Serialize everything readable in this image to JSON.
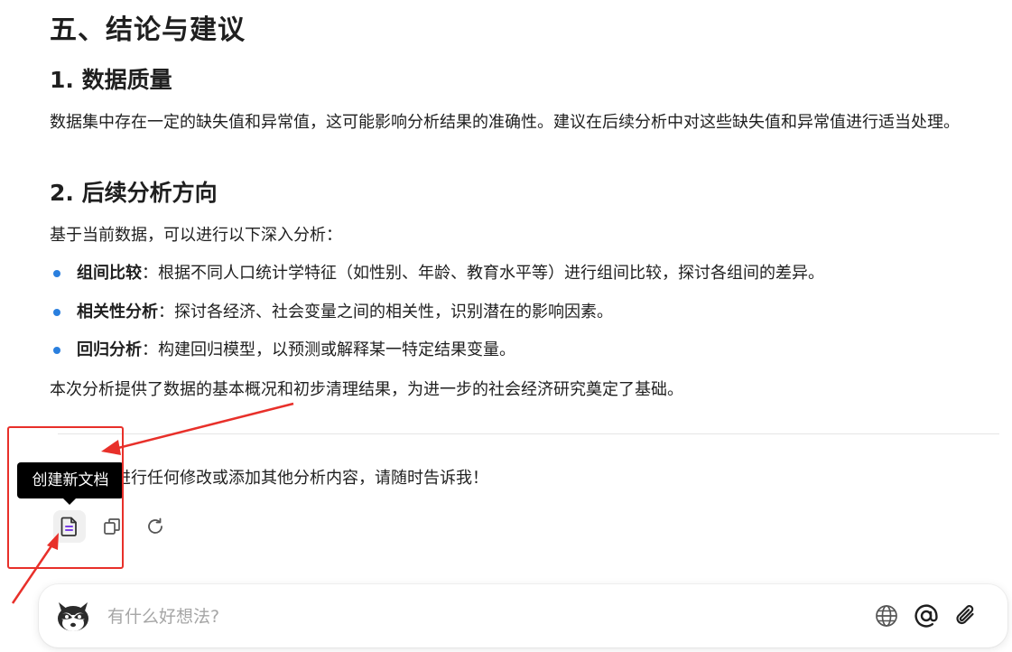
{
  "report": {
    "section_title": "五、结论与建议",
    "sub1_title": "1. 数据质量",
    "sub1_body": "数据集中存在一定的缺失值和异常值，这可能影响分析结果的准确性。建议在后续分析中对这些缺失值和异常值进行适当处理。",
    "sub2_title": "2. 后续分析方向",
    "sub2_intro": "基于当前数据，可以进行以下深入分析：",
    "bullets": [
      {
        "term": "组间比较",
        "text": "：根据不同人口统计学特征（如性别、年龄、教育水平等）进行组间比较，探讨各组间的差异。"
      },
      {
        "term": "相关性分析",
        "text": "：探讨各经济、社会变量之间的相关性，识别潜在的影响因素。"
      },
      {
        "term": "回归分析",
        "text": "：构建回归模型，以预测或解释某一特定结果变量。"
      }
    ],
    "closing": "本次分析提供了数据的基本概况和初步清理结果，为进一步的社会经济研究奠定了基础。"
  },
  "followup_text": "要对报告进行任何修改或添加其他分析内容，请随时告诉我！",
  "tooltip": "创建新文档",
  "actions": [
    {
      "name": "create-document",
      "icon": "document-icon"
    },
    {
      "name": "copy",
      "icon": "copy-icon"
    },
    {
      "name": "regenerate",
      "icon": "refresh-icon"
    }
  ],
  "input": {
    "placeholder": "有什么好想法?",
    "icons": [
      "globe-icon",
      "at-icon",
      "paperclip-icon"
    ]
  },
  "colors": {
    "accent_bullet": "#2a7fde",
    "annotation_red": "#e8302a",
    "doc_icon_purple": "#7b3fe4"
  }
}
